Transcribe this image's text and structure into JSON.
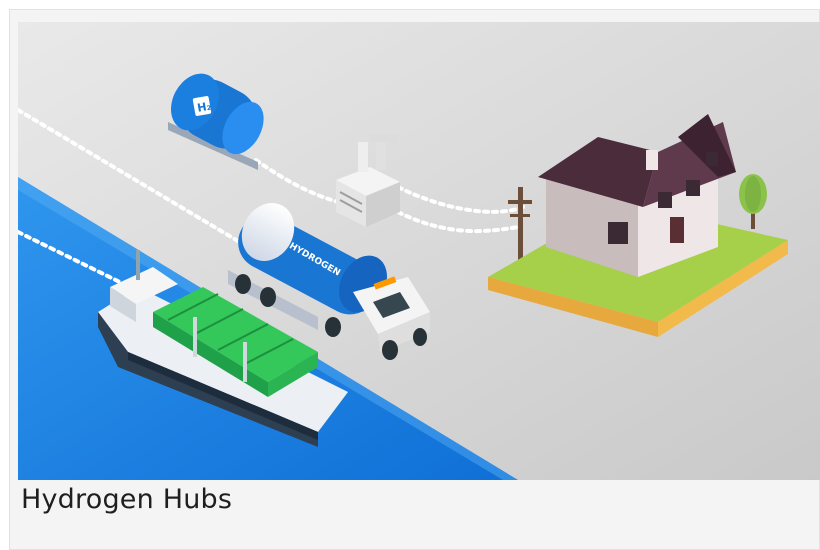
{
  "card": {
    "caption": "Hydrogen Hubs"
  },
  "illustration": {
    "truck_tank_text": "HYDROGEN",
    "storage_tank_text": "H₂",
    "colors": {
      "sea": "#1e88e5",
      "ground": "#d9d9d9",
      "tank_blue": "#1976d2",
      "containers": "#34c759",
      "grass": "#a6cf4a",
      "roof": "#4a2c3b",
      "house_wall": "#efe7e7"
    }
  }
}
